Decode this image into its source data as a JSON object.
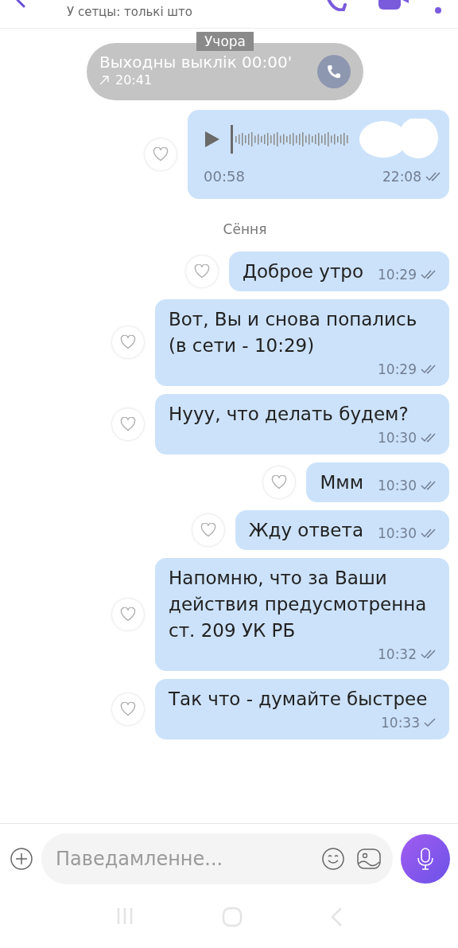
{
  "header": {
    "status": "У сетцы: толькі што"
  },
  "call": {
    "title": "Выходны выклік 00:00'",
    "outgoing": true,
    "time": "20:41"
  },
  "date_badges": [
    {
      "label": "Учора",
      "kind": "overlay"
    },
    {
      "label": "Сёння",
      "kind": "plain"
    }
  ],
  "voice_message": {
    "duration": "00:58",
    "time": "22:08",
    "read": true,
    "liked": false
  },
  "messages": [
    {
      "text": "Доброе утро",
      "time": "10:29",
      "read": true,
      "liked": false
    },
    {
      "text": "Вот, Вы и снова попались (в сети - 10:29)",
      "time": "10:29",
      "read": true,
      "liked": false
    },
    {
      "text": "Нууу, что делать будем?",
      "time": "10:30",
      "read": true,
      "liked": false
    },
    {
      "text": "Ммм",
      "time": "10:30",
      "read": true,
      "liked": false
    },
    {
      "text": "Жду ответа",
      "time": "10:30",
      "read": true,
      "liked": false
    },
    {
      "text": "Напомню, что за Ваши действия предусмотренна ст. 209 УК РБ",
      "time": "10:32",
      "read": true,
      "liked": false
    },
    {
      "text": "Так что - думайте быстрее",
      "time": "10:33",
      "read": false,
      "liked": false
    }
  ],
  "composer": {
    "placeholder": "Паведамленне..."
  }
}
